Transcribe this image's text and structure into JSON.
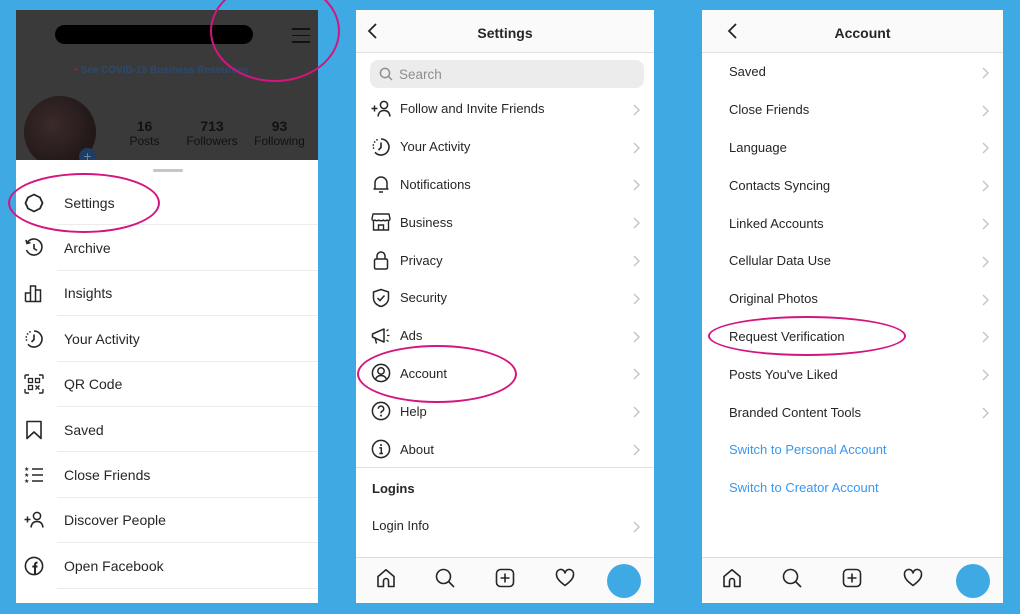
{
  "panel1": {
    "covid_link": "See COVID-19 Business Resources",
    "stats": [
      {
        "value": "16",
        "label": "Posts"
      },
      {
        "value": "713",
        "label": "Followers"
      },
      {
        "value": "93",
        "label": "Following"
      }
    ],
    "menu": [
      {
        "icon": "settings-icon",
        "label": "Settings"
      },
      {
        "icon": "archive-icon",
        "label": "Archive"
      },
      {
        "icon": "insights-icon",
        "label": "Insights"
      },
      {
        "icon": "activity-icon",
        "label": "Your Activity"
      },
      {
        "icon": "qr-code-icon",
        "label": "QR Code"
      },
      {
        "icon": "bookmark-icon",
        "label": "Saved"
      },
      {
        "icon": "close-friends-icon",
        "label": "Close Friends"
      },
      {
        "icon": "add-person-icon",
        "label": "Discover People"
      },
      {
        "icon": "facebook-icon",
        "label": "Open Facebook"
      }
    ]
  },
  "panel2": {
    "title": "Settings",
    "search_placeholder": "Search",
    "items": [
      {
        "icon": "add-person-icon",
        "label": "Follow and Invite Friends"
      },
      {
        "icon": "activity-icon",
        "label": "Your Activity"
      },
      {
        "icon": "bell-icon",
        "label": "Notifications"
      },
      {
        "icon": "shop-icon",
        "label": "Business"
      },
      {
        "icon": "lock-icon",
        "label": "Privacy"
      },
      {
        "icon": "shield-icon",
        "label": "Security"
      },
      {
        "icon": "megaphone-icon",
        "label": "Ads"
      },
      {
        "icon": "account-icon",
        "label": "Account"
      },
      {
        "icon": "help-icon",
        "label": "Help"
      },
      {
        "icon": "info-icon",
        "label": "About"
      }
    ],
    "section_header": "Logins",
    "login_item": "Login Info"
  },
  "panel3": {
    "title": "Account",
    "items": [
      {
        "label": "Saved"
      },
      {
        "label": "Close Friends"
      },
      {
        "label": "Language"
      },
      {
        "label": "Contacts Syncing"
      },
      {
        "label": "Linked Accounts"
      },
      {
        "label": "Cellular Data Use"
      },
      {
        "label": "Original Photos"
      },
      {
        "label": "Request Verification"
      },
      {
        "label": "Posts You've Liked"
      },
      {
        "label": "Branded Content Tools"
      }
    ],
    "links": [
      {
        "label": "Switch to Personal Account"
      },
      {
        "label": "Switch to Creator Account"
      }
    ]
  },
  "tabbar": [
    "home-icon",
    "search-icon",
    "new-post-icon",
    "heart-icon",
    "profile-avatar"
  ],
  "colors": {
    "background": "#3fa9e4",
    "highlight_ring": "#d4157f",
    "link": "#3897f0"
  }
}
